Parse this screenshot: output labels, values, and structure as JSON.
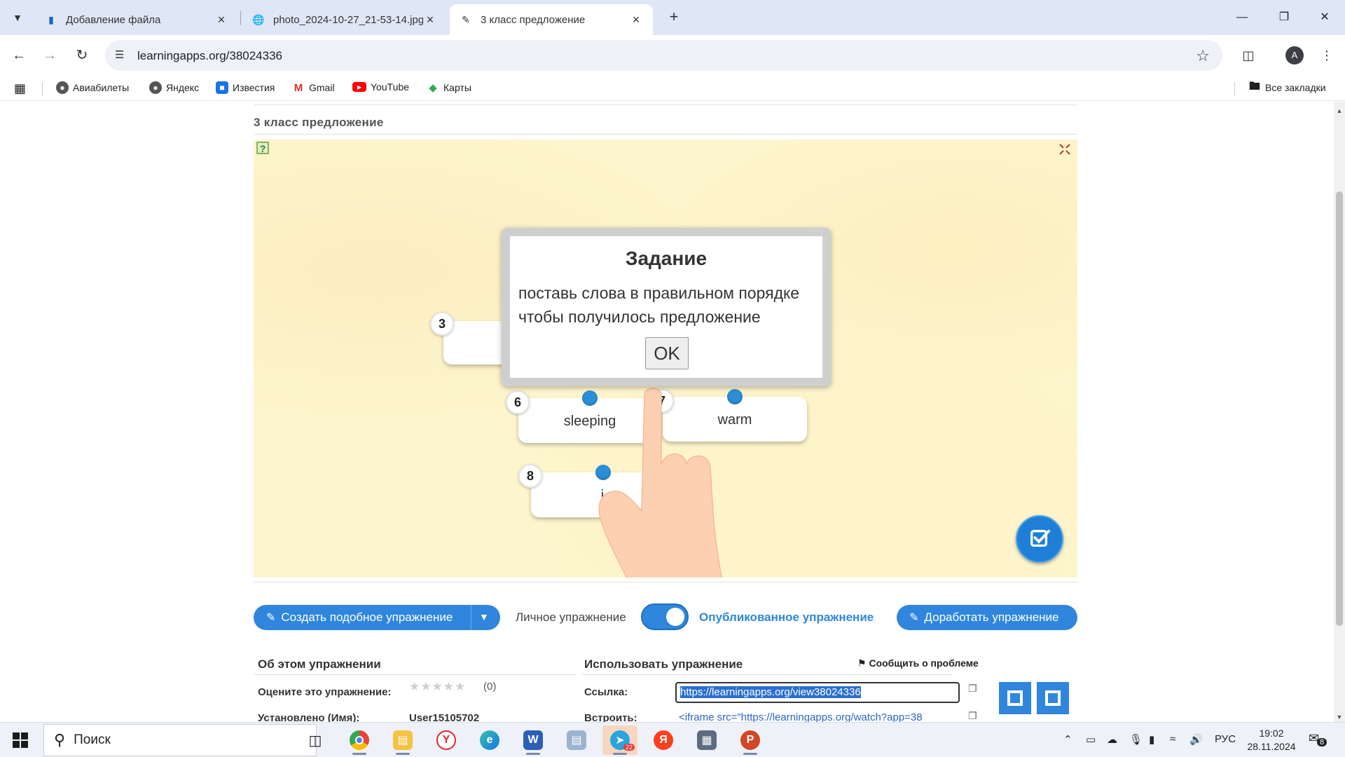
{
  "browser": {
    "tabs": [
      {
        "title": "Добавление файла",
        "active": false
      },
      {
        "title": "photo_2024-10-27_21-53-14.jpg",
        "active": false
      },
      {
        "title": "3 класс предложение",
        "active": true
      }
    ],
    "url": "learningapps.org/38024336",
    "avatar_letter": "A",
    "bookmarks": [
      "Авиабилеты",
      "Яндекс",
      "Известия",
      "Gmail",
      "YouTube",
      "Карты"
    ],
    "all_bookmarks": "Все закладки"
  },
  "page": {
    "title": "3 класс предложение",
    "app": {
      "cards": [
        {
          "number": "3",
          "text": ""
        },
        {
          "number": "6",
          "text": "sleeping"
        },
        {
          "number": "7",
          "text": "warm"
        },
        {
          "number": "8",
          "text": "i"
        }
      ],
      "dialog": {
        "title": "Задание",
        "text": "поставь слова в правильном порядке чтобы получилось предложение",
        "ok": "OK"
      }
    },
    "actions": {
      "create_similar": "Создать подобное упражнение",
      "private_label": "Личное упражнение",
      "published_label": "Опубликованное упражнение",
      "edit": "Доработать упражнение"
    },
    "about": {
      "title": "Об этом упражнении",
      "rate_label": "Оцените это упражнение:",
      "rating_count": "(0)",
      "installed_label": "Установлено (Имя):",
      "installed_value": "User15105702"
    },
    "use": {
      "title": "Использовать упражнение",
      "report": "Сообщить о проблеме",
      "link_label": "Ссылка:",
      "link_value": "https://learningapps.org/view38024336",
      "embed_label": "Встроить:",
      "embed_value": "<iframe src=\"https://learningapps.org/watch?app=38"
    }
  },
  "taskbar": {
    "search_placeholder": "Поиск",
    "language": "РУС",
    "time": "19:02",
    "date": "28.11.2024",
    "telegram_badge": "22",
    "notifications": "8"
  },
  "colors": {
    "accent": "#2f86dc",
    "app_background": "#fdf5cd",
    "tab_strip": "#dfe6f5"
  }
}
